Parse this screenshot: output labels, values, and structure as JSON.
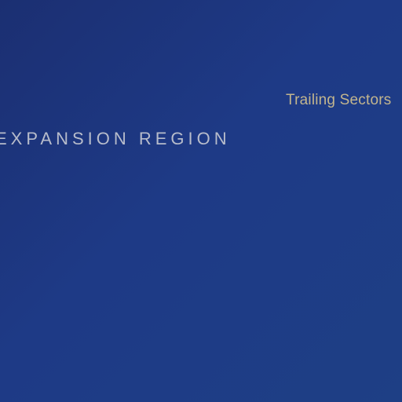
{
  "labels": {
    "trailing_sectors": "Trailing Sectors",
    "expansion_region": "EXPANSION REGION"
  },
  "colors": {
    "background_start": "#1b2f72",
    "background_end": "#1e3f85",
    "sectors_label": "#c2b58e",
    "region_label": "#b7bccb"
  }
}
